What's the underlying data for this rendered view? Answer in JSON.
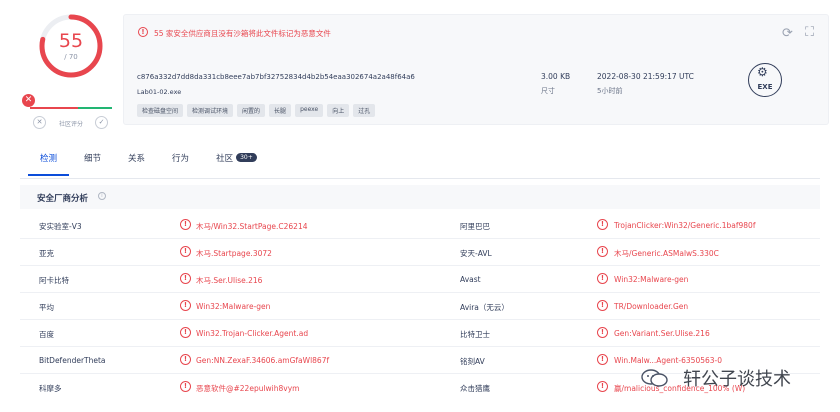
{
  "score": {
    "value": "55",
    "total": "/ 70",
    "detected": 55,
    "total_count": 70
  },
  "community": {
    "label": "社区评分"
  },
  "file": {
    "warning": "55 家安全供应商且没有沙箱将此文件标记为恶意文件",
    "hash": "c876a332d7dd8da331cb8eee7ab7bf32752834d4b2b54eaa302674a2a48f64a6",
    "name": "Lab01-02.exe",
    "tags": [
      "检查磁盘空间",
      "检测调试环境",
      "闲置的",
      "长腿",
      "peexe",
      "向上",
      "过孔"
    ],
    "size": "3.00 KB",
    "size_label": "尺寸",
    "date": "2022-08-30 21:59:17 UTC",
    "date_ago": "5小时前",
    "type": "EXE"
  },
  "tabs": [
    {
      "label": "检测"
    },
    {
      "label": "细节"
    },
    {
      "label": "关系"
    },
    {
      "label": "行为"
    },
    {
      "label": "社区"
    }
  ],
  "community_badge": "30+",
  "section_title": "安全厂商分析",
  "rows": [
    {
      "v1": "安实验室-V3",
      "d1": "木马/Win32.StartPage.C26214",
      "v2": "阿里巴巴",
      "d2": "TrojanClicker:Win32/Generic.1baf980f"
    },
    {
      "v1": "亚克",
      "d1": "木马.Startpage.3072",
      "v2": "安天-AVL",
      "d2": "木马/Generic.ASMalwS.330C"
    },
    {
      "v1": "阿卡比特",
      "d1": "木马.Ser.Ulise.216",
      "v2": "Avast",
      "d2": "Win32:Malware-gen"
    },
    {
      "v1": "平均",
      "d1": "Win32:Malware-gen",
      "v2": "Avira（无云）",
      "d2": "TR/Downloader.Gen"
    },
    {
      "v1": "百度",
      "d1": "Win32.Trojan-Clicker.Agent.ad",
      "v2": "比特卫士",
      "d2": "Gen:Variant.Ser.Ulise.216"
    },
    {
      "v1": "BitDefenderTheta",
      "d1": "Gen:NN.ZexaF.34606.amGfaWl867f",
      "v2": "铭刻AV",
      "d2": "Win.Malw...Agent-6350563-0"
    },
    {
      "v1": "科摩多",
      "d1": "恶意软件@#22epulwih8vym",
      "v2": "众击猎鹰",
      "d2": "赢/malicious_confidence_100% (W)"
    }
  ],
  "watermark": "轩公子谈技术",
  "colors": {
    "accent": "#0b4dda",
    "danger": "#e8464e",
    "text": "#313d5a"
  }
}
